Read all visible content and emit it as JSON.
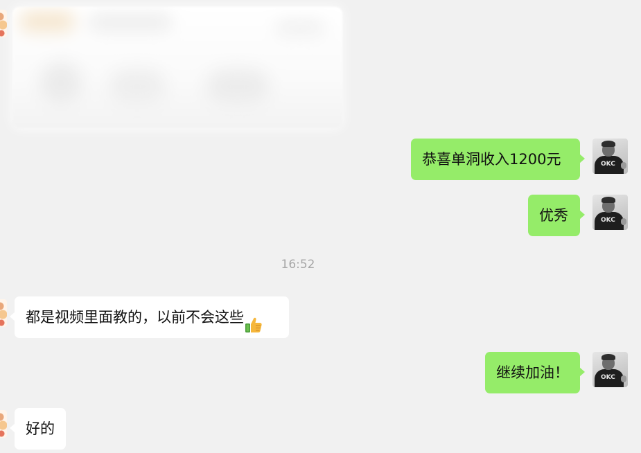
{
  "messages": {
    "m1_text": "恭喜单洞收入1200元",
    "m2_text": "优秀",
    "timestamp": "16:52",
    "m3_text": "都是视频里面教的，以前不会这些",
    "m4_text": "继续加油！",
    "m5_text": "好的"
  },
  "avatar": {
    "shirt_text": "OKC"
  },
  "colors": {
    "self_bubble": "#95ec69",
    "other_bubble": "#ffffff",
    "background": "#f1f1f1",
    "timestamp": "#a6a6a6"
  },
  "icons": {
    "blurred_attachment": "image-thumbnail",
    "thumbs_up": "thumbs-up-emoji"
  }
}
